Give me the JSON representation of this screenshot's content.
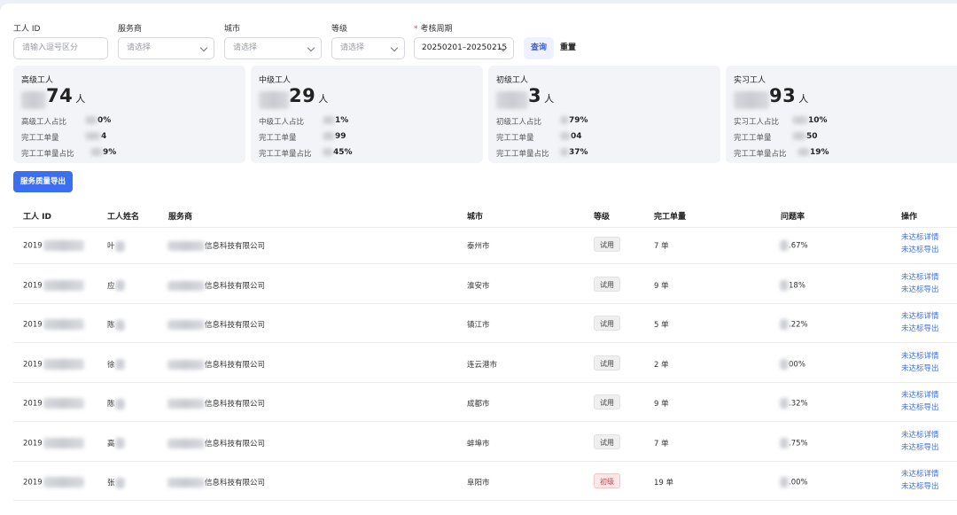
{
  "filters": {
    "worker_id": {
      "label": "工人 ID",
      "placeholder": "请输入逗号区分"
    },
    "provider": {
      "label": "服务商",
      "value": "请选择"
    },
    "city": {
      "label": "城市",
      "value": "请选择"
    },
    "level": {
      "label": "等级",
      "value": "请选择"
    },
    "period": {
      "label": "考核周期",
      "required_mark": "*",
      "value": "20250201–20250215"
    },
    "query_label": "查询",
    "reset_label": "重置"
  },
  "cards": [
    {
      "title": "高级工人",
      "count_visible": "74",
      "unit": "人",
      "rows": [
        {
          "label": "高级工人占比",
          "value": "0%"
        },
        {
          "label": "完工工单量",
          "value": "4"
        },
        {
          "label": "完工工单量占比",
          "value": "9%"
        }
      ]
    },
    {
      "title": "中级工人",
      "count_visible": "29",
      "unit": "人",
      "rows": [
        {
          "label": "中级工人占比",
          "value": "1%"
        },
        {
          "label": "完工工单量",
          "value": "99"
        },
        {
          "label": "完工工单量占比",
          "value": "45%"
        }
      ]
    },
    {
      "title": "初级工人",
      "count_visible": "3",
      "unit": "人",
      "rows": [
        {
          "label": "初级工人占比",
          "value": "79%"
        },
        {
          "label": "完工工单量",
          "value": "04"
        },
        {
          "label": "完工工单量占比",
          "value": "37%"
        }
      ]
    },
    {
      "title": "实习工人",
      "count_visible": "93",
      "unit": "人",
      "rows": [
        {
          "label": "实习工人占比",
          "value": "10%"
        },
        {
          "label": "完工工单量",
          "value": "50"
        },
        {
          "label": "完工工单量占比",
          "value": "19%"
        }
      ]
    }
  ],
  "export_button": "服务质量导出",
  "table": {
    "headers": [
      "工人 ID",
      "工人姓名",
      "服务商",
      "城市",
      "等级",
      "完工单量",
      "问题率",
      "操作"
    ],
    "rows": [
      {
        "id": "2019",
        "name": "叶",
        "provider": "信息科技有限公司",
        "city": "泰州市",
        "level": "试用",
        "level_kind": "trial",
        "count": "7 单",
        "rate": ".67%"
      },
      {
        "id": "2019",
        "name": "应",
        "provider": "信息科技有限公司",
        "city": "淮安市",
        "level": "试用",
        "level_kind": "trial",
        "count": "9 单",
        "rate": "18%"
      },
      {
        "id": "2019",
        "name": "陈",
        "provider": "信息科技有限公司",
        "city": "镇江市",
        "level": "试用",
        "level_kind": "trial",
        "count": "5 单",
        "rate": ".22%"
      },
      {
        "id": "2019",
        "name": "徐",
        "provider": "信息科技有限公司",
        "city": "连云港市",
        "level": "试用",
        "level_kind": "trial",
        "count": "2 单",
        "rate": "00%"
      },
      {
        "id": "2019",
        "name": "陈",
        "provider": "信息科技有限公司",
        "city": "成都市",
        "level": "试用",
        "level_kind": "trial",
        "count": "9 单",
        "rate": ".32%"
      },
      {
        "id": "2019",
        "name": "高",
        "provider": "信息科技有限公司",
        "city": "蚌埠市",
        "level": "试用",
        "level_kind": "trial",
        "count": "7 单",
        "rate": ".75%"
      },
      {
        "id": "2019",
        "name": "张",
        "provider": "信息科技有限公司",
        "city": "阜阳市",
        "level": "初级",
        "level_kind": "junior",
        "count": "19 单",
        "rate": ".00%"
      }
    ],
    "op_detail": "未达标详情",
    "op_export": "未达标导出"
  },
  "colors": {
    "primary": "#3c6ef2",
    "junior_badge": "#d9363e",
    "card_bg": "#f3f4f7"
  }
}
